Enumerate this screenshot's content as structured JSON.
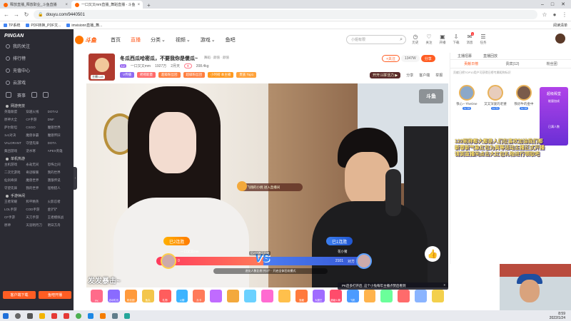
{
  "browser": {
    "tabs": [
      {
        "label": "释放直播_释放职业_斗鱼直播",
        "active": false
      },
      {
        "label": "一口又又mm直播_舞蹈直播 - 斗鱼",
        "active": true
      }
    ],
    "new_tab": "+",
    "url": "douyu.com/9440501",
    "bookmarks": [
      "TP系统",
      "PDF转换_PDF文...",
      "imvisionn直播_舞..."
    ],
    "reading_list": "阅读清单"
  },
  "header": {
    "logo_text": "斗鱼",
    "nav": [
      {
        "label": "首页",
        "active": false
      },
      {
        "label": "直播",
        "active": true
      },
      {
        "label": "分类",
        "active": false
      },
      {
        "label": "视频",
        "active": false
      },
      {
        "label": "游戏",
        "active": false
      },
      {
        "label": "鱼吧",
        "active": false
      }
    ],
    "search_placeholder": "小姐有限",
    "icons": [
      {
        "name": "history-icon",
        "label": "历史"
      },
      {
        "name": "follow-icon",
        "label": "关注"
      },
      {
        "name": "shop-icon",
        "label": "开播"
      },
      {
        "name": "download-icon",
        "label": "下载"
      },
      {
        "name": "message-icon",
        "label": "消息"
      },
      {
        "name": "task-icon",
        "label": "任务"
      }
    ],
    "message_badge": "1"
  },
  "sidebar": {
    "brand": "PINGAN",
    "items": [
      {
        "icon": "heart-icon",
        "label": "我的关注"
      },
      {
        "icon": "rank-icon",
        "label": "排行榜"
      },
      {
        "icon": "shop-icon",
        "label": "充值中心"
      },
      {
        "icon": "cloud-icon",
        "label": "云游戏"
      }
    ],
    "quick_icons": [
      "赛事",
      "鱼吧",
      "主播"
    ],
    "sections": [
      {
        "title": "网游竞技",
        "items": [
          "英雄联盟",
          "穿越火线",
          "DOTA2",
          "原神大全",
          "CF手游",
          "DNF",
          "萨尔斯坦",
          "CSGO",
          "魔兽世界",
          "1v1对决",
          "魔兽争霸",
          "魔兽怀旧",
          "VALORANT",
          "守望先锋",
          "DOTA",
          "集团游戏",
          "逆水寒",
          "APEX英雄"
        ]
      },
      {
        "title": "单机热游",
        "items": [
          "主机游戏",
          "永劫无间",
          "恐怖之间",
          "二次元游戏",
          "奇迹暖暖",
          "我的世界",
          "仙剑奇侠",
          "魔兽世界",
          "饿狼传说",
          "守望先锋",
          "我的世界",
          "怪物猎人"
        ]
      },
      {
        "title": "手游休闲",
        "items": [
          "王者荣耀",
          "和平精英",
          "火影忍者",
          "LOL手游",
          "COD手游",
          "金铲铲",
          "CF手游",
          "天刀手游",
          "王者模拟战",
          "原神",
          "天涯明月刀",
          "明日方舟"
        ]
      }
    ],
    "buttons": [
      "客户端下载",
      "鱼吧开播"
    ]
  },
  "room": {
    "title": "冬瓜西瓜哈密瓜，不要我你是傻瓜~",
    "category": "舞蹈 · 颜值 · 颜值",
    "host_level": "主播 Lv5",
    "host_name": "一口又又mm",
    "fans": "1927万",
    "stat1": "2月天",
    "popularity": "208.4kg",
    "badges": [
      {
        "label": "V传播",
        "color": "#8e6bf0"
      },
      {
        "label": "摇摇能量",
        "color": "#ff6b6b"
      },
      {
        "label": "超级粉丝团",
        "color": "#ff7f3f"
      },
      {
        "label": "超级粉丝团",
        "color": "#ff7f3f"
      },
      {
        "label": "小时榜 本主播",
        "color": "#ff9a20"
      },
      {
        "label": "贵族 Top1",
        "color": "#ffa33c"
      }
    ],
    "follow_label": "+关注",
    "follow_count": "1347W",
    "share_label": "分享",
    "report_label": "举报",
    "quiz_label": "开开斗拼活力 ▶",
    "tools": [
      "分享",
      "客户端",
      "举报"
    ]
  },
  "video": {
    "watermark": "斗鱼",
    "join_msg": "飞翔的小桃 进入直播间",
    "pk": {
      "left_win": "已2连胜",
      "right_win": "已1连胜",
      "left_label": "我方",
      "left_score": "0",
      "right_label": "对方",
      "right_score": "2101",
      "left_host": "一口又又mm",
      "right_host": "花小猪",
      "vs": "VS",
      "notice": "进化人数比例 共3个 · 开启全体狂欢模式",
      "top_notice": "后2分钟可开始"
    },
    "caption": "发发暴击~"
  },
  "giftbar": {
    "items": [
      "PK",
      "活动礼包",
      "粉丝团",
      "鱼丸",
      "礼物",
      "火箭",
      "办卡",
      "",
      "",
      "",
      "",
      "",
      "宝藏",
      "大魔王",
      "超级火箭",
      "飞机",
      "",
      "",
      "",
      "",
      ""
    ]
  },
  "pk_alert": "PK后多打开后, 这个小兔每年主播点赞后看到",
  "right_panel": {
    "tabs_top": [
      "主播招募",
      "直播回放"
    ],
    "tabs": [
      {
        "label": "贡献日榜",
        "active": true
      },
      {
        "label": "贵宾(12)",
        "active": false
      },
      {
        "label": "粉丝团",
        "active": false
      }
    ],
    "note": "贡献日榜TOP10用户可获得日榜专属昵称标识",
    "ranks": [
      {
        "name": "铁心~ TheOne",
        "level": "Lv 16"
      },
      {
        "name": "又又深爱的老婆",
        "level": "Lv 21"
      },
      {
        "name": "铁砂牛的金中",
        "level": "Lv 16"
      }
    ],
    "promo_title": "超级殿堂",
    "promo_sub": "能量加成",
    "promo_more": "已满人数",
    "chat_banner": "122昵称都大都是人们在喜欢加油我们都\n新春新气象红包为真等活动主播正式开播\n请到直播间点击大红包礼物进行领取吧"
  },
  "taskbar": {
    "time": "8:59",
    "date": "2022/1/24"
  }
}
